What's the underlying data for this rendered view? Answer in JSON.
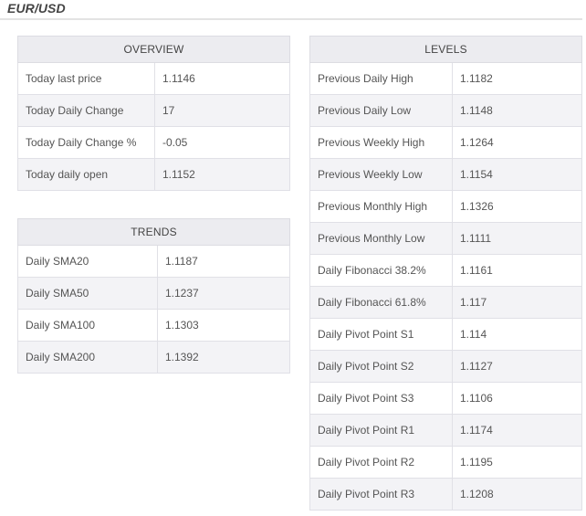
{
  "title": "EUR/USD",
  "overview": {
    "header": "OVERVIEW",
    "rows": [
      {
        "label": "Today last price",
        "value": "1.1146"
      },
      {
        "label": "Today Daily Change",
        "value": "17"
      },
      {
        "label": "Today Daily Change %",
        "value": "-0.05"
      },
      {
        "label": "Today daily open",
        "value": "1.1152"
      }
    ]
  },
  "trends": {
    "header": "TRENDS",
    "rows": [
      {
        "label": "Daily SMA20",
        "value": "1.1187"
      },
      {
        "label": "Daily SMA50",
        "value": "1.1237"
      },
      {
        "label": "Daily SMA100",
        "value": "1.1303"
      },
      {
        "label": "Daily SMA200",
        "value": "1.1392"
      }
    ]
  },
  "levels": {
    "header": "LEVELS",
    "rows": [
      {
        "label": "Previous Daily High",
        "value": "1.1182"
      },
      {
        "label": "Previous Daily Low",
        "value": "1.1148"
      },
      {
        "label": "Previous Weekly High",
        "value": "1.1264"
      },
      {
        "label": "Previous Weekly Low",
        "value": "1.1154"
      },
      {
        "label": "Previous Monthly High",
        "value": "1.1326"
      },
      {
        "label": "Previous Monthly Low",
        "value": "1.1111"
      },
      {
        "label": "Daily Fibonacci 38.2%",
        "value": "1.1161"
      },
      {
        "label": "Daily Fibonacci 61.8%",
        "value": "1.117"
      },
      {
        "label": "Daily Pivot Point S1",
        "value": "1.114"
      },
      {
        "label": "Daily Pivot Point S2",
        "value": "1.1127"
      },
      {
        "label": "Daily Pivot Point S3",
        "value": "1.1106"
      },
      {
        "label": "Daily Pivot Point R1",
        "value": "1.1174"
      },
      {
        "label": "Daily Pivot Point R2",
        "value": "1.1195"
      },
      {
        "label": "Daily Pivot Point R3",
        "value": "1.1208"
      }
    ]
  }
}
